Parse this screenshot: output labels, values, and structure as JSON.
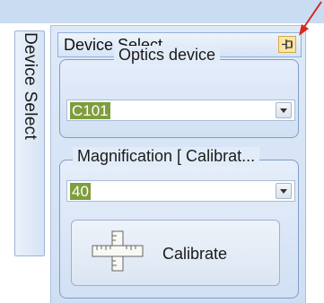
{
  "side_tab": {
    "label": "Device Select"
  },
  "panel": {
    "title": "Device Select",
    "pin_icon": "pin-icon"
  },
  "optics": {
    "group_title": "Optics device",
    "selected": "C101"
  },
  "magnification": {
    "group_title": "Magnification [ Calibrat...",
    "selected": "40"
  },
  "calibrate": {
    "label": "Calibrate",
    "icon": "ruler-calibrate-icon"
  },
  "colors": {
    "panel_bg": "#dfeaf8",
    "border": "#7f9dc6",
    "selection": "#7f9d3d",
    "pin_bg": "#fbe6a4",
    "annotation_arrow": "#d42a1e"
  }
}
